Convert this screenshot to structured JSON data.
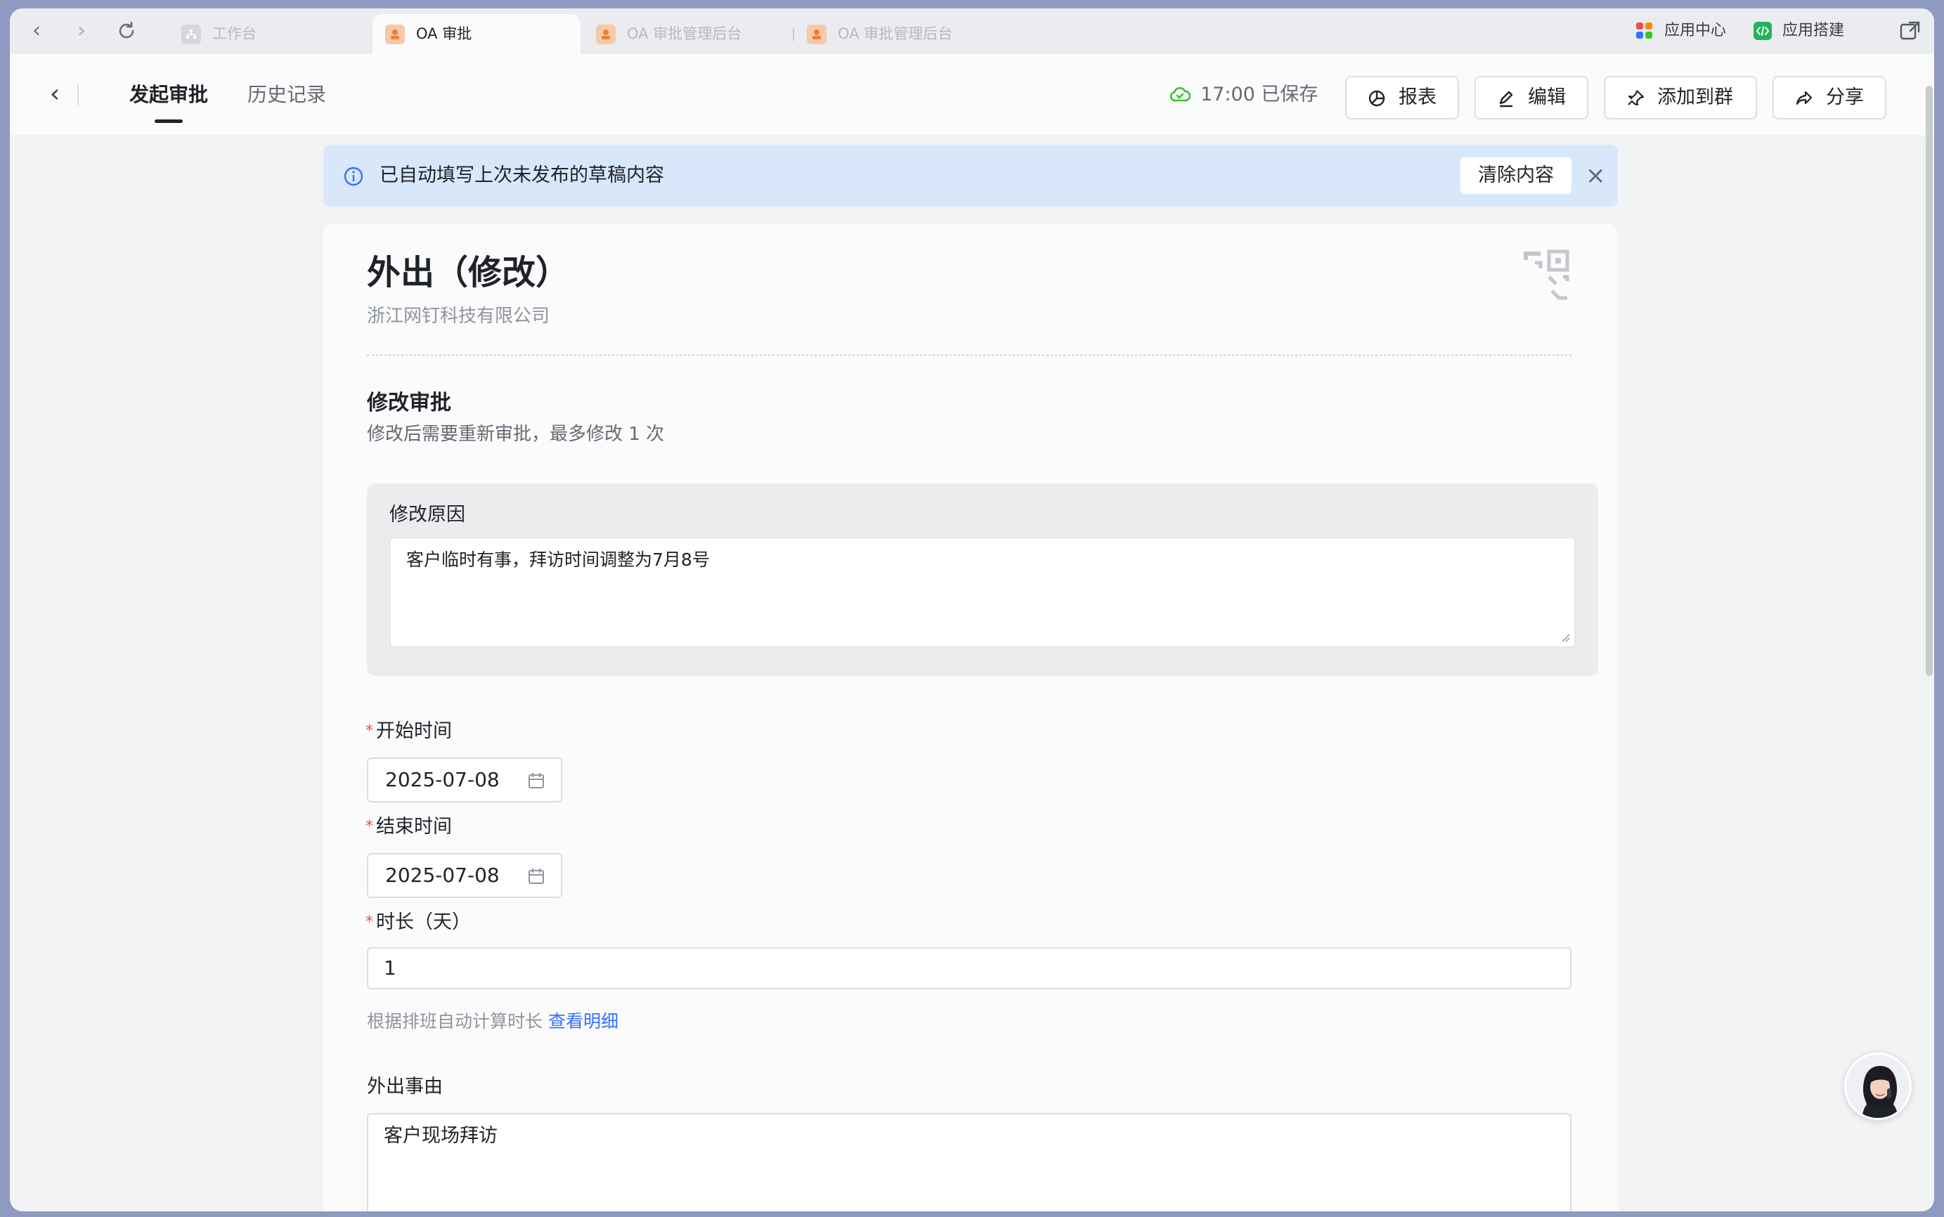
{
  "browser": {
    "tabs": [
      {
        "label": "工作台",
        "active": false
      },
      {
        "label": "OA 审批",
        "active": true
      },
      {
        "label": "OA 审批管理后台",
        "active": false
      },
      {
        "label": "OA 审批管理后台",
        "active": false
      }
    ],
    "right_items": [
      {
        "label": "应用中心",
        "icon": "app-center-icon"
      },
      {
        "label": "应用搭建",
        "icon": "app-builder-icon"
      }
    ]
  },
  "header": {
    "tabs": [
      {
        "label": "发起审批",
        "active": true
      },
      {
        "label": "历史记录",
        "active": false
      }
    ],
    "saved_status": "17:00 已保存",
    "buttons": [
      {
        "label": "报表",
        "icon": "report-icon"
      },
      {
        "label": "编辑",
        "icon": "edit-icon"
      },
      {
        "label": "添加到群",
        "icon": "pin-icon"
      },
      {
        "label": "分享",
        "icon": "share-icon"
      }
    ]
  },
  "banner": {
    "message": "已自动填写上次未发布的草稿内容",
    "clear_label": "清除内容"
  },
  "form": {
    "title": "外出（修改）",
    "company": "浙江网钉科技有限公司",
    "section_title": "修改审批",
    "section_subtitle": "修改后需要重新审批，最多修改 1 次",
    "reason_label": "修改原因",
    "reason_value": "客户临时有事，拜访时间调整为7月8号",
    "start_label": "开始时间",
    "start_value": "2025-07-08",
    "end_label": "结束时间",
    "end_value": "2025-07-08",
    "duration_label": "时长（天）",
    "duration_value": "1",
    "hint_text": "根据排班自动计算时长",
    "hint_link": "查看明细",
    "reason_out_label": "外出事由",
    "reason_out_value": "客户现场拜访"
  },
  "colors": {
    "accent": "#3370ff",
    "required": "#f54a45",
    "saved_green": "#34c724",
    "banner_bg": "#d9e7fb"
  }
}
